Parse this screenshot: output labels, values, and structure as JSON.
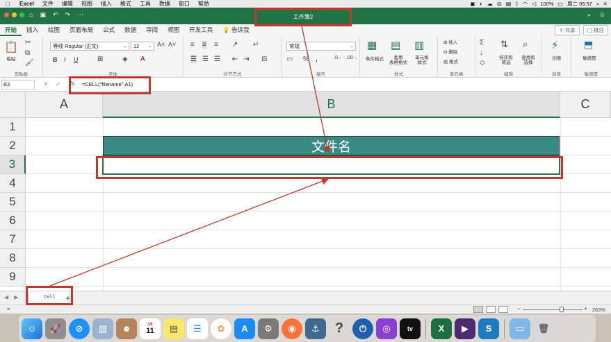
{
  "menubar": {
    "app_name": "Excel",
    "items": [
      "文件",
      "编辑",
      "视图",
      "插入",
      "格式",
      "工具",
      "数据",
      "窗口",
      "帮助"
    ],
    "battery": "100%",
    "datetime": "周二 05:57"
  },
  "window": {
    "title": "工作簿2"
  },
  "ribbon_tabs": [
    "开始",
    "插入",
    "绘图",
    "页面布局",
    "公式",
    "数据",
    "审阅",
    "视图",
    "开发工具"
  ],
  "tell_me": "告诉我",
  "share_label": "共享",
  "comments_label": "批注",
  "ribbon": {
    "paste_label": "粘贴",
    "clipboard_group": "剪贴板",
    "font_name": "等线 Regular (正文)",
    "font_size": "12",
    "font_group": "字体",
    "bold": "B",
    "italic": "I",
    "underline": "U",
    "alignment_group": "对齐方式",
    "number_format": "常规",
    "number_group": "编号",
    "percent": "%",
    "conditional_format": "条件格式",
    "table_format": [
      "套用",
      "表格格式"
    ],
    "cell_style": [
      "单元格",
      "样式"
    ],
    "styles_group": "样式",
    "insert_label": "插入",
    "delete_label": "删除",
    "format_label": "格式",
    "cells_group": "单元格",
    "sort_filter": [
      "排序和",
      "筛选"
    ],
    "find_select": [
      "查找和",
      "选择"
    ],
    "editing_group": "编辑",
    "creativity": "创意",
    "creativity_group": "创意",
    "sensitivity": "敏感度",
    "sensitivity_group": "敏感度"
  },
  "formula_bar": {
    "name_box": "B3",
    "fx": "fx",
    "formula": "=CELL(\"filename\",A1)"
  },
  "grid": {
    "columns": [
      "A",
      "B",
      "C"
    ],
    "rows": [
      "1",
      "2",
      "3",
      "4",
      "5",
      "6",
      "7",
      "8",
      "9"
    ],
    "header_cell_text": "文件名"
  },
  "sheet": {
    "tab_name": "Cell",
    "add": "+"
  },
  "status": {
    "zoom_minus": "−",
    "zoom_plus": "+",
    "zoom": "263%"
  },
  "dock": {
    "calendar_month": "2月",
    "calendar_day": "11",
    "help": "?",
    "tv": "tv"
  },
  "colors": {
    "excel_green": "#217346",
    "header_fill": "#3a8a86",
    "annotation": "#c0392b"
  }
}
